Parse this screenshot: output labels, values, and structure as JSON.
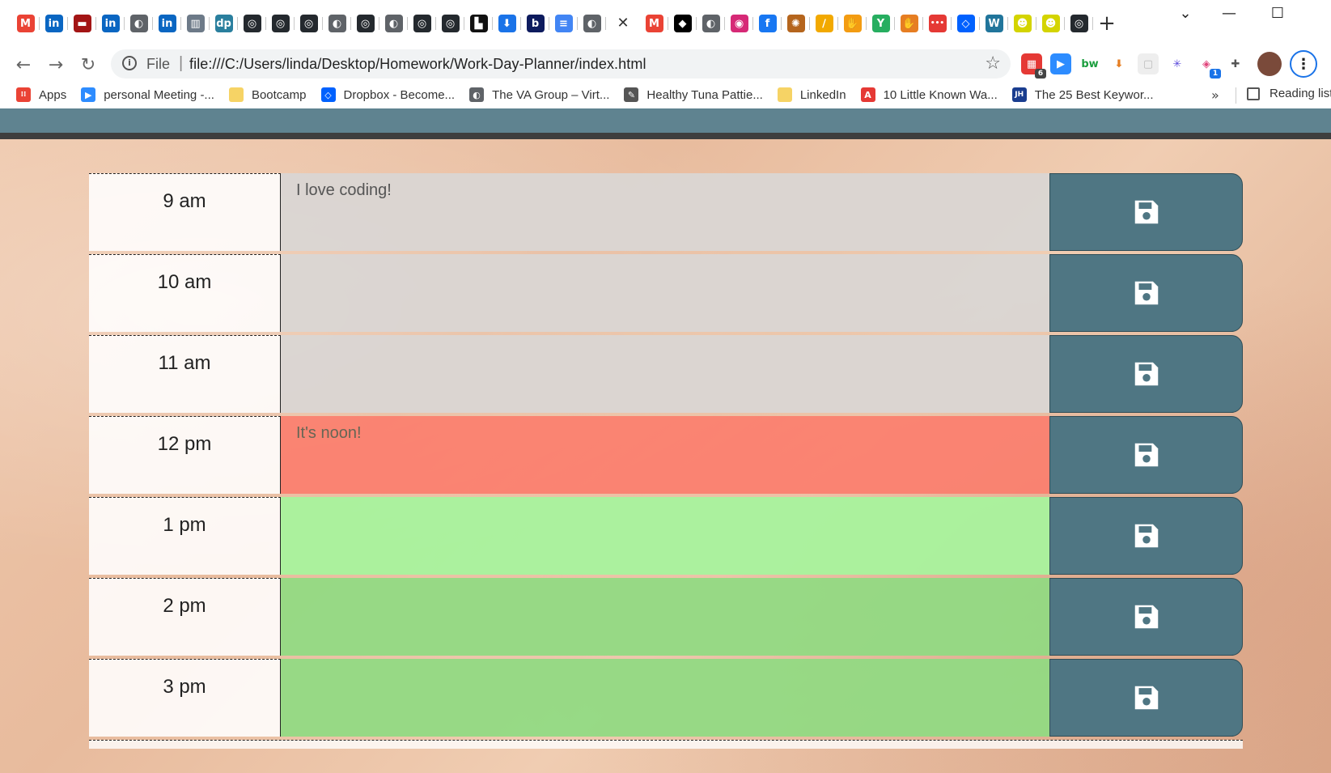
{
  "browser": {
    "tabs": [
      {
        "icon": "gmail-icon",
        "glyph": "M",
        "bg": "#ea4335"
      },
      {
        "icon": "linkedin-icon",
        "glyph": "in",
        "bg": "#0a66c2"
      },
      {
        "icon": "bookmark-red-icon",
        "glyph": "▬",
        "bg": "#a31515"
      },
      {
        "icon": "linkedin-icon",
        "glyph": "in",
        "bg": "#0a66c2"
      },
      {
        "icon": "globe-icon",
        "glyph": "◐",
        "bg": "#5f6368"
      },
      {
        "icon": "linkedin-icon",
        "glyph": "in",
        "bg": "#0a66c2"
      },
      {
        "icon": "bank-icon",
        "glyph": "▥",
        "bg": "#6d7a88"
      },
      {
        "icon": "dp-icon",
        "glyph": "dp",
        "bg": "#2a7f9e"
      },
      {
        "icon": "github-icon",
        "glyph": "◎",
        "bg": "#24292e"
      },
      {
        "icon": "github-icon",
        "glyph": "◎",
        "bg": "#24292e"
      },
      {
        "icon": "github-icon",
        "glyph": "◎",
        "bg": "#24292e"
      },
      {
        "icon": "globe-icon",
        "glyph": "◐",
        "bg": "#5f6368"
      },
      {
        "icon": "github-icon",
        "glyph": "◎",
        "bg": "#24292e"
      },
      {
        "icon": "globe-icon",
        "glyph": "◐",
        "bg": "#5f6368"
      },
      {
        "icon": "github-icon",
        "glyph": "◎",
        "bg": "#24292e"
      },
      {
        "icon": "github-icon",
        "glyph": "◎",
        "bg": "#24292e"
      },
      {
        "icon": "printer-icon",
        "glyph": "▙",
        "bg": "#111111"
      },
      {
        "icon": "download-icon",
        "glyph": "⬇",
        "bg": "#1a73e8"
      },
      {
        "icon": "b-icon",
        "glyph": "b",
        "bg": "#0d1b5e"
      },
      {
        "icon": "docs-icon",
        "glyph": "≡",
        "bg": "#4285f4"
      },
      {
        "icon": "globe-icon",
        "glyph": "◐",
        "bg": "#5f6368"
      },
      {
        "icon": "close-tab-icon",
        "glyph": "✕",
        "bg": "",
        "active": true
      },
      {
        "icon": "gmail-icon",
        "glyph": "M",
        "bg": "#ea4335"
      },
      {
        "icon": "tag-icon",
        "glyph": "◆",
        "bg": "#000000"
      },
      {
        "icon": "globe-icon",
        "glyph": "◐",
        "bg": "#5f6368"
      },
      {
        "icon": "instagram-icon",
        "glyph": "◉",
        "bg": "#d62976"
      },
      {
        "icon": "facebook-icon",
        "glyph": "f",
        "bg": "#1877f2"
      },
      {
        "icon": "crest-icon",
        "glyph": "✺",
        "bg": "#b5651d"
      },
      {
        "icon": "pencil-icon",
        "glyph": "∕",
        "bg": "#f2a900"
      },
      {
        "icon": "hand-icon",
        "glyph": "✋",
        "bg": "#f39c12"
      },
      {
        "icon": "y-logo-icon",
        "glyph": "Y",
        "bg": "#27ae60"
      },
      {
        "icon": "hand-icon",
        "glyph": "✋",
        "bg": "#e67e22"
      },
      {
        "icon": "ellipsis-red-icon",
        "glyph": "•••",
        "bg": "#e53935"
      },
      {
        "icon": "dropbox-icon",
        "glyph": "◇",
        "bg": "#0061fe"
      },
      {
        "icon": "wordpress-icon",
        "glyph": "W",
        "bg": "#21759b"
      },
      {
        "icon": "mascot-icon",
        "glyph": "☻",
        "bg": "#d4d400"
      },
      {
        "icon": "mascot-icon",
        "glyph": "☻",
        "bg": "#d4d400"
      },
      {
        "icon": "github-icon",
        "glyph": "◎",
        "bg": "#24292e"
      }
    ],
    "new_tab_glyph": "+",
    "window_controls": {
      "dropdown": "⌄",
      "minimize": "—",
      "maximize": "☐",
      "close": "✕"
    },
    "nav": {
      "back": "←",
      "forward": "→",
      "reload": "↻"
    },
    "omnibox": {
      "info_glyph": "i",
      "scheme_label": "File",
      "separator": "|",
      "url": "file:///C:/Users/linda/Desktop/Homework/Work-Day-Planner/index.html",
      "star_glyph": "☆"
    },
    "extensions": [
      {
        "icon": "calendar-ext-icon",
        "glyph": "▦",
        "bg": "#e53935",
        "badge": "6",
        "badge_bg": "#444"
      },
      {
        "icon": "zoom-ext-icon",
        "glyph": "▶",
        "bg": "#2d8cff"
      },
      {
        "icon": "bw-ext-icon",
        "glyph": "bw",
        "bg": "#ffffff",
        "fg": "#1b9e3e"
      },
      {
        "icon": "download-ext-icon",
        "glyph": "⬇",
        "bg": "#ffffff",
        "fg": "#e67e22"
      },
      {
        "icon": "blank-ext-icon",
        "glyph": "▢",
        "bg": "#eeeeee",
        "fg": "#bbb"
      },
      {
        "icon": "snowflake-ext-icon",
        "glyph": "✳",
        "bg": "#ffffff",
        "fg": "#5b4bdb"
      },
      {
        "icon": "tag-ext-icon",
        "glyph": "◈",
        "bg": "#ffffff",
        "fg": "#e0457b",
        "badge": "1",
        "badge_bg": "#1a73e8"
      },
      {
        "icon": "puzzle-icon",
        "glyph": "✚",
        "bg": "#ffffff",
        "fg": "#555"
      }
    ],
    "menu_glyph": "⋮",
    "bookmarks": [
      {
        "icon": "apps-grid-icon",
        "glyph": "⁞⁞",
        "bg": "#ea4335",
        "label": "Apps"
      },
      {
        "icon": "zoom-icon",
        "glyph": "▶",
        "bg": "#2d8cff",
        "label": "personal Meeting -..."
      },
      {
        "icon": "folder-icon",
        "glyph": "",
        "bg": "#f6d365",
        "label": "Bootcamp"
      },
      {
        "icon": "dropbox-icon",
        "glyph": "◇",
        "bg": "#0061fe",
        "label": "Dropbox - Become..."
      },
      {
        "icon": "globe-icon",
        "glyph": "◐",
        "bg": "#5f6368",
        "label": "The VA Group – Virt..."
      },
      {
        "icon": "recipe-icon",
        "glyph": "✎",
        "bg": "#555555",
        "label": "Healthy Tuna Pattie..."
      },
      {
        "icon": "folder-icon",
        "glyph": "",
        "bg": "#f6d365",
        "label": "LinkedIn"
      },
      {
        "icon": "a-logo-icon",
        "glyph": "A",
        "bg": "#e53935",
        "label": "10 Little Known Wa..."
      },
      {
        "icon": "jh-icon",
        "glyph": "JH",
        "bg": "#1a3d8f",
        "label": "The 25 Best Keywor..."
      }
    ],
    "more_glyph": "»",
    "reading_list_label": "Reading list"
  },
  "planner": {
    "rows": [
      {
        "hour": "9 am",
        "text": "I love coding!",
        "state": "past"
      },
      {
        "hour": "10 am",
        "text": "",
        "state": "past"
      },
      {
        "hour": "11 am",
        "text": "",
        "state": "past"
      },
      {
        "hour": "12 pm",
        "text": "It's noon!",
        "state": "present"
      },
      {
        "hour": "1 pm",
        "text": "",
        "state": "future-1"
      },
      {
        "hour": "2 pm",
        "text": "",
        "state": "future"
      },
      {
        "hour": "3 pm",
        "text": "",
        "state": "future"
      }
    ],
    "save_icon": "save-icon"
  },
  "colors": {
    "header": "#5f8390",
    "save_button": "#4f7683",
    "past": "#d9d6d4",
    "present": "#fb7e6e",
    "future": "#90da82"
  }
}
